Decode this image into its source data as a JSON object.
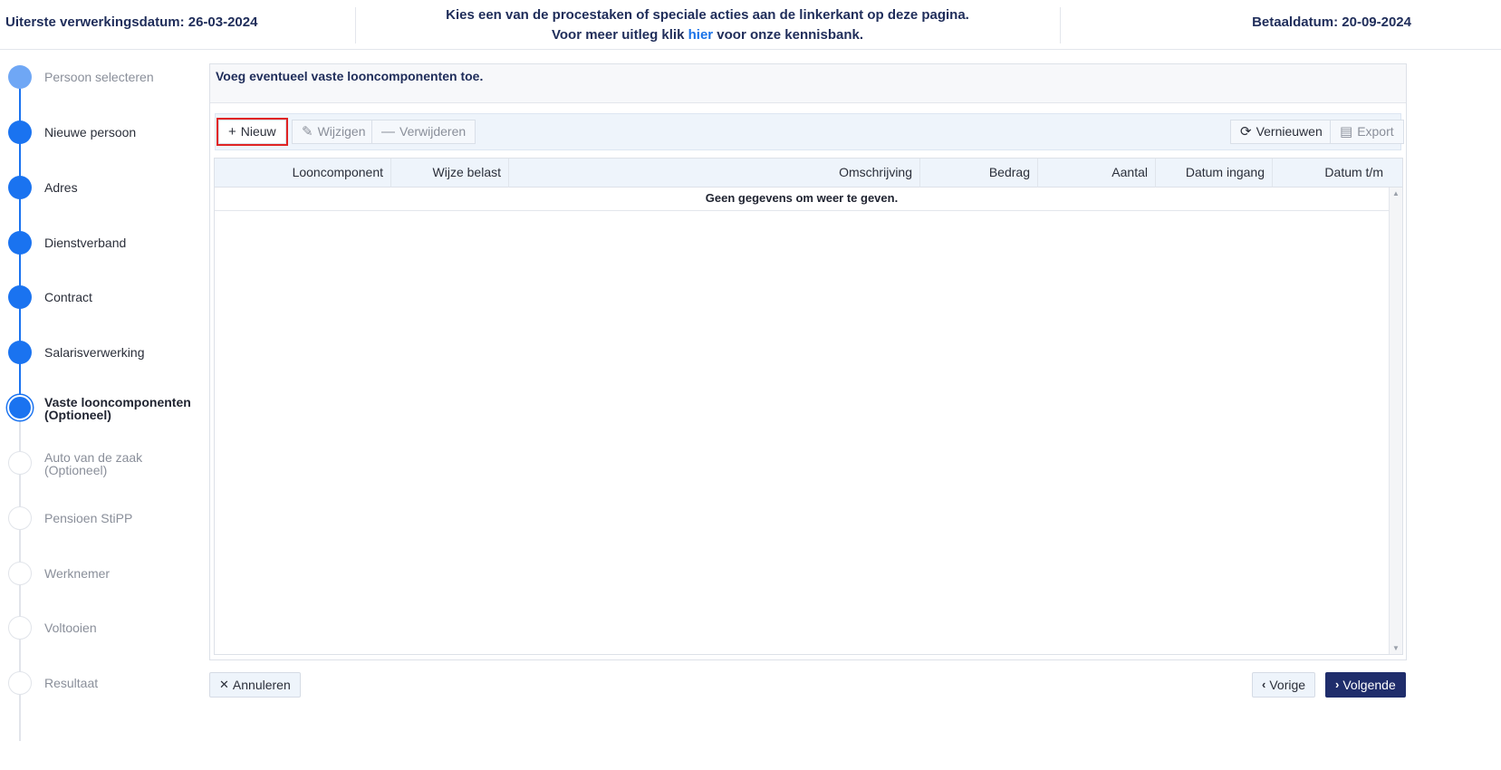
{
  "header": {
    "deadline": "Uiterste verwerkingsdatum: 26-03-2024",
    "info_line1": "Kies een van de procestaken of speciale acties aan de linkerkant op deze pagina.",
    "info_line2_pre": "Voor meer uitleg klik ",
    "info_link": "hier",
    "info_line2_post": " voor onze kennisbank.",
    "paydate": "Betaaldatum: 20-09-2024"
  },
  "steps": [
    {
      "label": "Persoon selecteren",
      "state": "first"
    },
    {
      "label": "Nieuwe persoon",
      "state": "done"
    },
    {
      "label": "Adres",
      "state": "done"
    },
    {
      "label": "Dienstverband",
      "state": "done"
    },
    {
      "label": "Contract",
      "state": "done"
    },
    {
      "label": "Salarisverwerking",
      "state": "done"
    },
    {
      "label": "Vaste looncomponenten",
      "sub": "(Optioneel)",
      "state": "current"
    },
    {
      "label": "Auto van de zaak",
      "sub": "(Optioneel)",
      "state": "pending"
    },
    {
      "label": "Pensioen StiPP",
      "state": "pending"
    },
    {
      "label": "Werknemer",
      "state": "pending"
    },
    {
      "label": "Voltooien",
      "state": "pending"
    },
    {
      "label": "Resultaat",
      "state": "pending"
    }
  ],
  "panel": {
    "title": "Voeg eventueel vaste looncomponenten toe."
  },
  "toolbar": {
    "new_label": "Nieuw",
    "edit_label": "Wijzigen",
    "delete_label": "Verwijderen",
    "refresh_label": "Vernieuwen",
    "export_label": "Export"
  },
  "grid": {
    "columns": [
      "Looncomponent",
      "Wijze belast",
      "Omschrijving",
      "Bedrag",
      "Aantal",
      "Datum ingang",
      "Datum t/m"
    ],
    "empty_message": "Geen gegevens om weer te geven."
  },
  "footer": {
    "cancel_label": "Annuleren",
    "prev_label": "Vorige",
    "next_label": "Volgende"
  },
  "colors": {
    "accent": "#1a73f0",
    "primary_button": "#1f2d6b",
    "highlight": "#e02424"
  }
}
